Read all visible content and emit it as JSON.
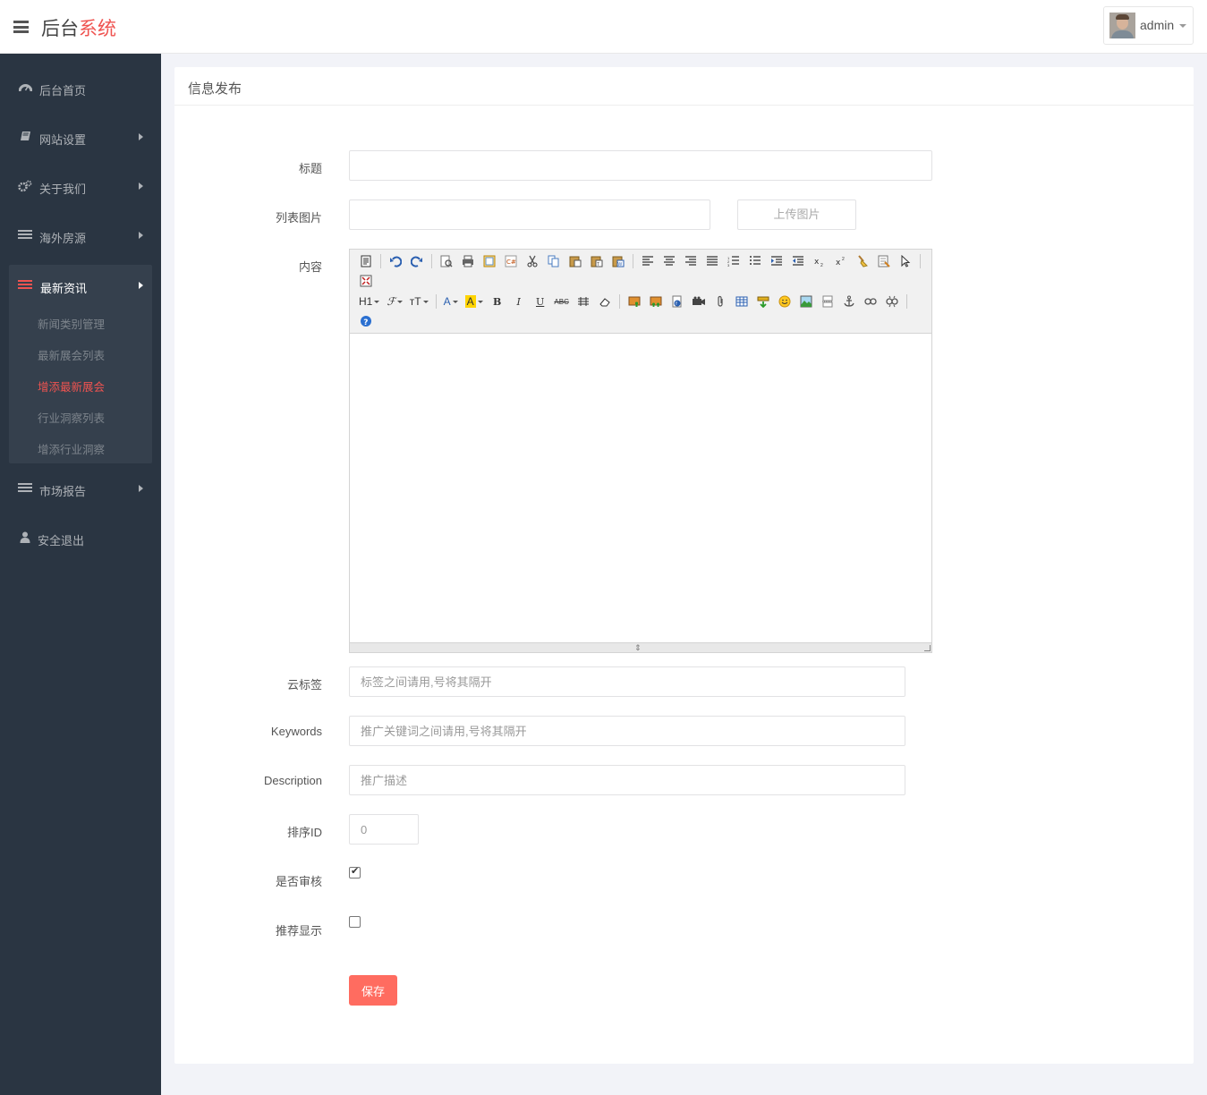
{
  "header": {
    "brand_main": "后台",
    "brand_accent": "系统",
    "username": "admin"
  },
  "sidebar": {
    "items": [
      {
        "label": "后台首页",
        "icon": "dashboard-icon"
      },
      {
        "label": "网站设置",
        "icon": "book-icon"
      },
      {
        "label": "关于我们",
        "icon": "cogs-icon"
      },
      {
        "label": "海外房源",
        "icon": "tasks-icon"
      },
      {
        "label": "最新资讯",
        "icon": "tasks-icon"
      },
      {
        "label": "市场报告",
        "icon": "tasks-icon"
      },
      {
        "label": "安全退出",
        "icon": "user-icon"
      }
    ],
    "submenu": [
      {
        "label": "新闻类别管理"
      },
      {
        "label": "最新展会列表"
      },
      {
        "label": "增添最新展会"
      },
      {
        "label": "行业洞察列表"
      },
      {
        "label": "增添行业洞察"
      }
    ]
  },
  "panel": {
    "title": "信息发布"
  },
  "form": {
    "title_label": "标题",
    "title_value": "",
    "image_label": "列表图片",
    "image_value": "",
    "upload_button": "上传图片",
    "content_label": "内容",
    "tags_label": "云标签",
    "tags_placeholder": "标签之间请用,号将其隔开",
    "keywords_label": "Keywords",
    "keywords_placeholder": "推广关键词之间请用,号将其隔开",
    "description_label": "Description",
    "description_placeholder": "推广描述",
    "sort_label": "排序ID",
    "sort_placeholder": "0",
    "audit_label": "是否审核",
    "audit_checked": true,
    "recommend_label": "推荐显示",
    "recommend_checked": false,
    "save_button": "保存"
  },
  "editor": {
    "toolbar_text": {
      "heading": "H1",
      "font_family": "ℱ",
      "font_size": "тT",
      "font_color": "A",
      "bg_color": "A",
      "bold": "B",
      "italic": "I",
      "underline": "U",
      "strikethrough": "ABC"
    }
  },
  "colors": {
    "accent": "#ef5350",
    "save_button": "#ff6c60",
    "sidebar_bg": "#2a3542",
    "sidebar_active_bg": "#35404d"
  }
}
